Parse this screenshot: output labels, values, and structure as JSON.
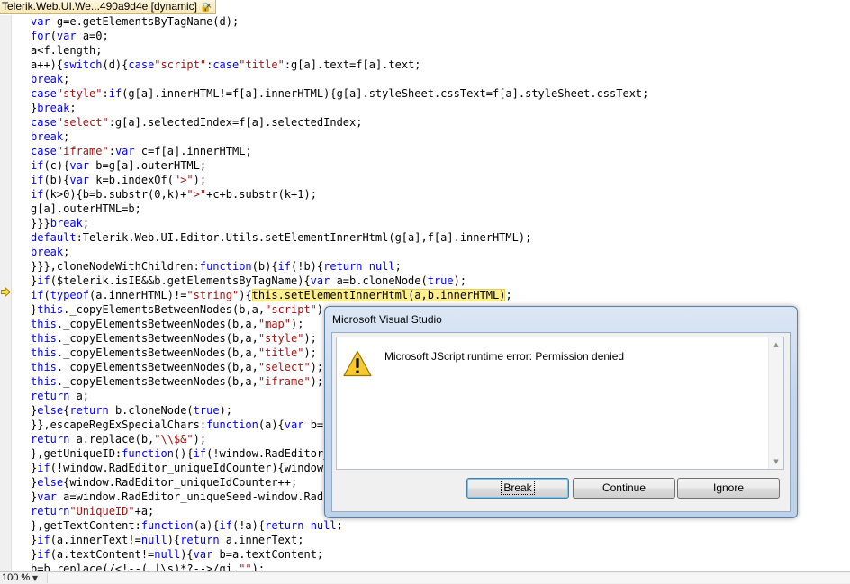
{
  "tab": {
    "title": "Telerik.Web.UI.We...490a9d4e [dynamic]",
    "lock_icon": "lock-icon",
    "close_glyph": "×"
  },
  "code_lines": [
    [
      {
        "t": "var",
        "c": "kw"
      },
      {
        "t": " g=e.getElementsByTagName(d);"
      }
    ],
    [
      {
        "t": "for",
        "c": "kw"
      },
      {
        "t": "("
      },
      {
        "t": "var",
        "c": "kw"
      },
      {
        "t": " a=0;"
      }
    ],
    [
      {
        "t": "a<f.length;"
      }
    ],
    [
      {
        "t": "a++){"
      },
      {
        "t": "switch",
        "c": "kw"
      },
      {
        "t": "(d){"
      },
      {
        "t": "case",
        "c": "kw"
      },
      {
        "t": "\"script\"",
        "c": "str"
      },
      {
        "t": ":"
      },
      {
        "t": "case",
        "c": "kw"
      },
      {
        "t": "\"title\"",
        "c": "str"
      },
      {
        "t": ":g[a].text=f[a].text;"
      }
    ],
    [
      {
        "t": "break",
        "c": "kw"
      },
      {
        "t": ";"
      }
    ],
    [
      {
        "t": "case",
        "c": "kw"
      },
      {
        "t": "\"style\"",
        "c": "str"
      },
      {
        "t": ":"
      },
      {
        "t": "if",
        "c": "kw"
      },
      {
        "t": "(g[a].innerHTML!=f[a].innerHTML){g[a].styleSheet.cssText=f[a].styleSheet.cssText;"
      }
    ],
    [
      {
        "t": "}"
      },
      {
        "t": "break",
        "c": "kw"
      },
      {
        "t": ";"
      }
    ],
    [
      {
        "t": "case",
        "c": "kw"
      },
      {
        "t": "\"select\"",
        "c": "str"
      },
      {
        "t": ":g[a].selectedIndex=f[a].selectedIndex;"
      }
    ],
    [
      {
        "t": "break",
        "c": "kw"
      },
      {
        "t": ";"
      }
    ],
    [
      {
        "t": "case",
        "c": "kw"
      },
      {
        "t": "\"iframe\"",
        "c": "str"
      },
      {
        "t": ":"
      },
      {
        "t": "var",
        "c": "kw"
      },
      {
        "t": " c=f[a].innerHTML;"
      }
    ],
    [
      {
        "t": "if",
        "c": "kw"
      },
      {
        "t": "(c){"
      },
      {
        "t": "var",
        "c": "kw"
      },
      {
        "t": " b=g[a].outerHTML;"
      }
    ],
    [
      {
        "t": "if",
        "c": "kw"
      },
      {
        "t": "(b){"
      },
      {
        "t": "var",
        "c": "kw"
      },
      {
        "t": " k=b.indexOf("
      },
      {
        "t": "\">\"",
        "c": "str"
      },
      {
        "t": ");"
      }
    ],
    [
      {
        "t": "if",
        "c": "kw"
      },
      {
        "t": "(k>0){b=b.substr(0,k)+"
      },
      {
        "t": "\">\"",
        "c": "str"
      },
      {
        "t": "+c+b.substr(k+1);"
      }
    ],
    [
      {
        "t": "g[a].outerHTML=b;"
      }
    ],
    [
      {
        "t": "}}}"
      },
      {
        "t": "break",
        "c": "kw"
      },
      {
        "t": ";"
      }
    ],
    [
      {
        "t": "default",
        "c": "kw"
      },
      {
        "t": ":Telerik.Web.UI.Editor.Utils.setElementInnerHtml(g[a],f[a].innerHTML);"
      }
    ],
    [
      {
        "t": "break",
        "c": "kw"
      },
      {
        "t": ";"
      }
    ],
    [
      {
        "t": "}}},cloneNodeWithChildren:"
      },
      {
        "t": "function",
        "c": "kw"
      },
      {
        "t": "(b){"
      },
      {
        "t": "if",
        "c": "kw"
      },
      {
        "t": "(!b){"
      },
      {
        "t": "return",
        "c": "kw"
      },
      {
        "t": " "
      },
      {
        "t": "null",
        "c": "kw"
      },
      {
        "t": ";"
      }
    ],
    [
      {
        "t": "}"
      },
      {
        "t": "if",
        "c": "kw"
      },
      {
        "t": "($telerik.isIE&&b.getElementsByTagName){"
      },
      {
        "t": "var",
        "c": "kw"
      },
      {
        "t": " a=b.cloneNode("
      },
      {
        "t": "true",
        "c": "kw"
      },
      {
        "t": ");"
      }
    ],
    [
      {
        "t": "if",
        "c": "kw"
      },
      {
        "t": "("
      },
      {
        "t": "typeof",
        "c": "kw"
      },
      {
        "t": "(a.innerHTML)!="
      },
      {
        "t": "\"string\"",
        "c": "str"
      },
      {
        "t": "){"
      },
      {
        "t": "this.setElementInnerHtml(a,b.innerHTML)",
        "c": "hl"
      },
      {
        "t": ";"
      }
    ],
    [
      {
        "t": "}"
      },
      {
        "t": "this",
        "c": "kw"
      },
      {
        "t": "._copyElementsBetweenNodes(b,a,"
      },
      {
        "t": "\"script\"",
        "c": "str"
      },
      {
        "t": ");"
      }
    ],
    [
      {
        "t": "this",
        "c": "kw"
      },
      {
        "t": "._copyElementsBetweenNodes(b,a,"
      },
      {
        "t": "\"map\"",
        "c": "str"
      },
      {
        "t": ");"
      }
    ],
    [
      {
        "t": "this",
        "c": "kw"
      },
      {
        "t": "._copyElementsBetweenNodes(b,a,"
      },
      {
        "t": "\"style\"",
        "c": "str"
      },
      {
        "t": ");"
      }
    ],
    [
      {
        "t": "this",
        "c": "kw"
      },
      {
        "t": "._copyElementsBetweenNodes(b,a,"
      },
      {
        "t": "\"title\"",
        "c": "str"
      },
      {
        "t": ");"
      }
    ],
    [
      {
        "t": "this",
        "c": "kw"
      },
      {
        "t": "._copyElementsBetweenNodes(b,a,"
      },
      {
        "t": "\"select\"",
        "c": "str"
      },
      {
        "t": ");"
      }
    ],
    [
      {
        "t": "this",
        "c": "kw"
      },
      {
        "t": "._copyElementsBetweenNodes(b,a,"
      },
      {
        "t": "\"iframe\"",
        "c": "str"
      },
      {
        "t": ");"
      }
    ],
    [
      {
        "t": "return",
        "c": "kw"
      },
      {
        "t": " a;"
      }
    ],
    [
      {
        "t": "}"
      },
      {
        "t": "else",
        "c": "kw"
      },
      {
        "t": "{"
      },
      {
        "t": "return",
        "c": "kw"
      },
      {
        "t": " b.cloneNode("
      },
      {
        "t": "true",
        "c": "kw"
      },
      {
        "t": ");"
      }
    ],
    [
      {
        "t": "}},escapeRegExSpecialChars:"
      },
      {
        "t": "function",
        "c": "kw"
      },
      {
        "t": "(a){"
      },
      {
        "t": "var",
        "c": "kw"
      },
      {
        "t": " b=ne"
      }
    ],
    [
      {
        "t": "return",
        "c": "kw"
      },
      {
        "t": " a.replace(b,"
      },
      {
        "t": "\"\\\\$&\"",
        "c": "str"
      },
      {
        "t": ");"
      }
    ],
    [
      {
        "t": "},getUniqueID:"
      },
      {
        "t": "function",
        "c": "kw"
      },
      {
        "t": "(){"
      },
      {
        "t": "if",
        "c": "kw"
      },
      {
        "t": "(!window.RadEditor_u"
      }
    ],
    [
      {
        "t": "}"
      },
      {
        "t": "if",
        "c": "kw"
      },
      {
        "t": "(!window.RadEditor_uniqueIdCounter){window.R"
      }
    ],
    [
      {
        "t": "}"
      },
      {
        "t": "else",
        "c": "kw"
      },
      {
        "t": "{window.RadEditor_uniqueIdCounter++;"
      }
    ],
    [
      {
        "t": "}"
      },
      {
        "t": "var",
        "c": "kw"
      },
      {
        "t": " a=window.RadEditor_uniqueSeed-window.RadEd"
      }
    ],
    [
      {
        "t": "return",
        "c": "kw"
      },
      {
        "t": "\"UniqueID\"",
        "c": "str"
      },
      {
        "t": "+a;"
      }
    ],
    [
      {
        "t": "},getTextContent:"
      },
      {
        "t": "function",
        "c": "kw"
      },
      {
        "t": "(a){"
      },
      {
        "t": "if",
        "c": "kw"
      },
      {
        "t": "(!a){"
      },
      {
        "t": "return",
        "c": "kw"
      },
      {
        "t": " "
      },
      {
        "t": "null",
        "c": "kw"
      },
      {
        "t": ";"
      }
    ],
    [
      {
        "t": "}"
      },
      {
        "t": "if",
        "c": "kw"
      },
      {
        "t": "(a.innerText!="
      },
      {
        "t": "null",
        "c": "kw"
      },
      {
        "t": "){"
      },
      {
        "t": "return",
        "c": "kw"
      },
      {
        "t": " a.innerText;"
      }
    ],
    [
      {
        "t": "}"
      },
      {
        "t": "if",
        "c": "kw"
      },
      {
        "t": "(a.textContent!="
      },
      {
        "t": "null",
        "c": "kw"
      },
      {
        "t": "){"
      },
      {
        "t": "var",
        "c": "kw"
      },
      {
        "t": " b=a.textContent;"
      }
    ],
    [
      {
        "t": "b=b.replace(/<!--(.|\\s)*?-->/gi,"
      },
      {
        "t": "\"\"",
        "c": "str"
      },
      {
        "t": ");"
      }
    ]
  ],
  "exec_pointer_icon": "execution-arrow-icon",
  "status_bar": {
    "zoom": "100 %",
    "zoom_dropdown_glyph": "▼"
  },
  "dialog": {
    "title": "Microsoft Visual Studio",
    "icon": "warning-icon",
    "message": "Microsoft JScript runtime error: Permission denied",
    "buttons": {
      "break_label": "Break",
      "continue_label": "Continue",
      "ignore_label": "Ignore"
    }
  },
  "colors": {
    "keyword": "#0000ff",
    "string": "#a31515",
    "highlight": "#ffef8e",
    "dialog_frame": "#c4d6ec"
  }
}
